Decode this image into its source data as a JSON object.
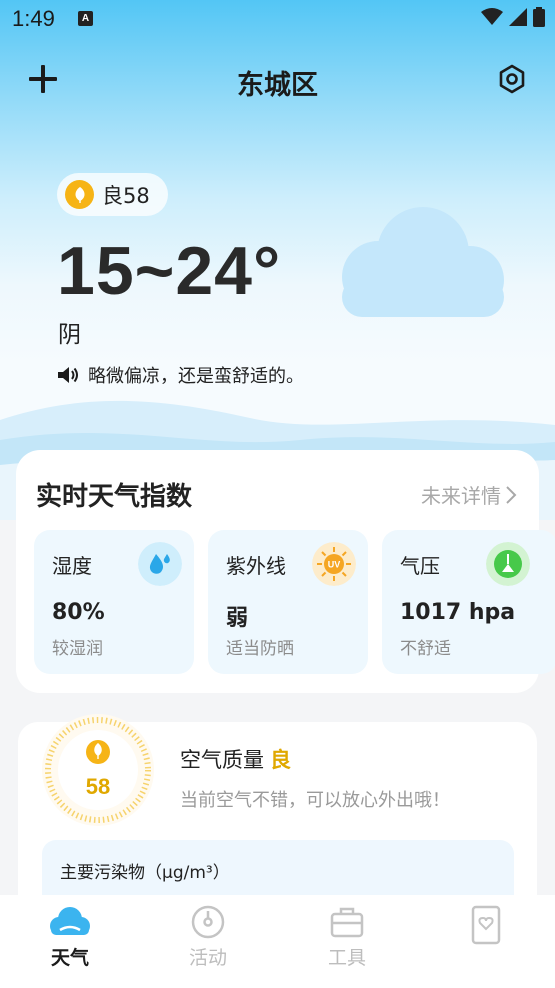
{
  "status_bar": {
    "time": "1:49",
    "notif": "A"
  },
  "header": {
    "title": "东城区"
  },
  "hero": {
    "aqi_label": "良58",
    "temp_range": "15~24°",
    "condition": "阴",
    "tip": "略微偏凉，还是蛮舒适的。"
  },
  "index_card": {
    "title": "实时天气指数",
    "more": "未来详情",
    "tiles": [
      {
        "name": "湿度",
        "value": "80%",
        "desc": "较湿润"
      },
      {
        "name": "紫外线",
        "value": "弱",
        "desc": "适当防晒"
      },
      {
        "name": "气压",
        "value": "1017 hpa",
        "desc": "不舒适"
      }
    ]
  },
  "air_card": {
    "score": "58",
    "title": "空气质量",
    "grade": "良",
    "desc": "当前空气不错，可以放心外出哦！",
    "pollutant_title": "主要污染物（μg/m³）"
  },
  "tabs": [
    {
      "label": "天气",
      "active": true
    },
    {
      "label": "活动",
      "active": false
    },
    {
      "label": "工具",
      "active": false
    },
    {
      "label": "",
      "active": false
    }
  ],
  "colors": {
    "accent_blue": "#3bb4ef",
    "aqi_yellow": "#f6b416",
    "uv_orange": "#f5a623",
    "pressure_green": "#47c94a"
  }
}
